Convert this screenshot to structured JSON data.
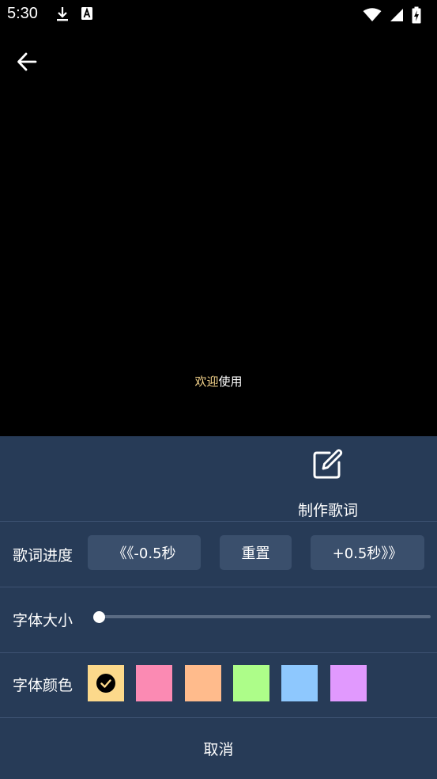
{
  "status_bar": {
    "time": "5:30",
    "icons_left": [
      "download-icon",
      "font-a-icon"
    ],
    "icons_right": [
      "wifi-icon",
      "cellular-signal-icon",
      "battery-charging-icon"
    ]
  },
  "lyric_display": {
    "highlight_text": "欢迎",
    "rest_text": "使用",
    "highlight_color": "#f3d28a"
  },
  "panel": {
    "background": "#273b57",
    "make_lyrics_label": "制作歌词",
    "progress": {
      "label": "歌词进度",
      "minus_button": "《《-0.5秒",
      "reset_button": "重置",
      "plus_button": "+0.5秒》》"
    },
    "font_size": {
      "label": "字体大小",
      "slider_value": 0
    },
    "font_color": {
      "label": "字体颜色",
      "selected_index": 0,
      "swatches": [
        "#fcd98b",
        "#fb8ab3",
        "#ffbb8c",
        "#adfd89",
        "#8ec8fe",
        "#e199fe"
      ]
    },
    "cancel_label": "取消"
  }
}
